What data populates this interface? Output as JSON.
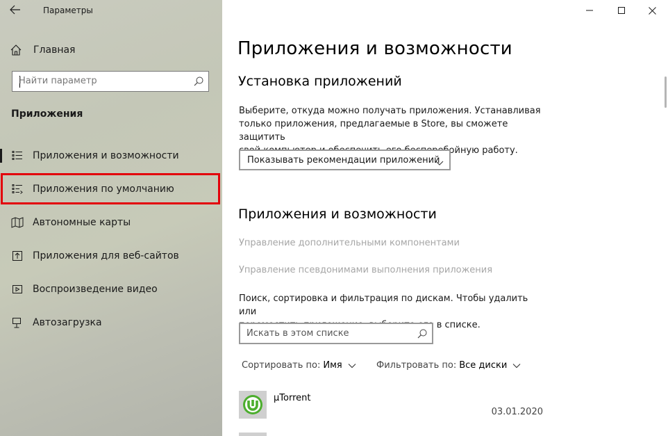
{
  "window": {
    "title": "Параметры",
    "controls": [
      "minimize",
      "maximize",
      "close"
    ]
  },
  "sidebar": {
    "home_label": "Главная",
    "search_placeholder": "Найти параметр",
    "section_title": "Приложения",
    "items": [
      {
        "label": "Приложения и возможности",
        "icon": "apps-features-icon",
        "active": true
      },
      {
        "label": "Приложения по умолчанию",
        "icon": "default-apps-icon",
        "active": false,
        "highlighted": true
      },
      {
        "label": "Автономные карты",
        "icon": "offline-maps-icon",
        "active": false
      },
      {
        "label": "Приложения для веб-сайтов",
        "icon": "apps-websites-icon",
        "active": false
      },
      {
        "label": "Воспроизведение видео",
        "icon": "video-playback-icon",
        "active": false
      },
      {
        "label": "Автозагрузка",
        "icon": "startup-icon",
        "active": false
      }
    ],
    "highlight_color": "#e3000b"
  },
  "main": {
    "page_title": "Приложения и возможности",
    "install": {
      "heading": "Установка приложений",
      "description_lines": [
        "Выберите, откуда можно получать приложения. Устанавливая",
        "только приложения, предлагаемые в Store, вы сможете защитить",
        "свой компьютер и обеспечить его бесперебойную работу."
      ],
      "dropdown_value": "Показывать рекомендации приложений"
    },
    "apps": {
      "heading": "Приложения и возможности",
      "link_optional": "Управление дополнительными компонентами",
      "link_aliases": "Управление псевдонимами выполнения приложения",
      "description_lines": [
        "Поиск, сортировка и фильтрация по дискам. Чтобы удалить или",
        "переместить приложение, выберите его в списке."
      ],
      "search_placeholder": "Искать в этом списке",
      "sort_label": "Сортировать по:",
      "sort_value": "Имя",
      "filter_label": "Фильтровать по:",
      "filter_value": "Все диски",
      "list": [
        {
          "name": "µTorrent",
          "date": "03.01.2020",
          "icon": "utorrent-icon"
        }
      ]
    }
  }
}
